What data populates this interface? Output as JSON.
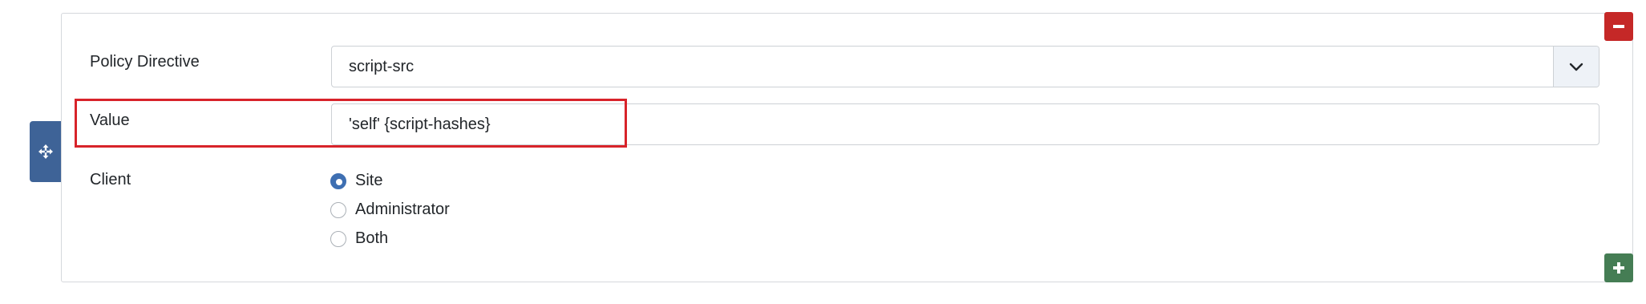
{
  "form": {
    "policy_directive": {
      "label": "Policy Directive",
      "selected": "script-src"
    },
    "value": {
      "label": "Value",
      "input_value": "'self' {script-hashes}"
    },
    "client": {
      "label": "Client",
      "options": [
        {
          "label": "Site",
          "checked": true
        },
        {
          "label": "Administrator",
          "checked": false
        },
        {
          "label": "Both",
          "checked": false
        }
      ]
    }
  },
  "controls": {
    "move_icon": "move-arrows-icon",
    "remove_icon": "minus-icon",
    "add_icon": "plus-icon",
    "dropdown_icon": "chevron-down-icon"
  },
  "colors": {
    "move_handle": "#3e6397",
    "remove_button": "#c52827",
    "add_button": "#457d54",
    "highlight_border": "#d8232a",
    "radio_checked": "#3e6fb2"
  }
}
